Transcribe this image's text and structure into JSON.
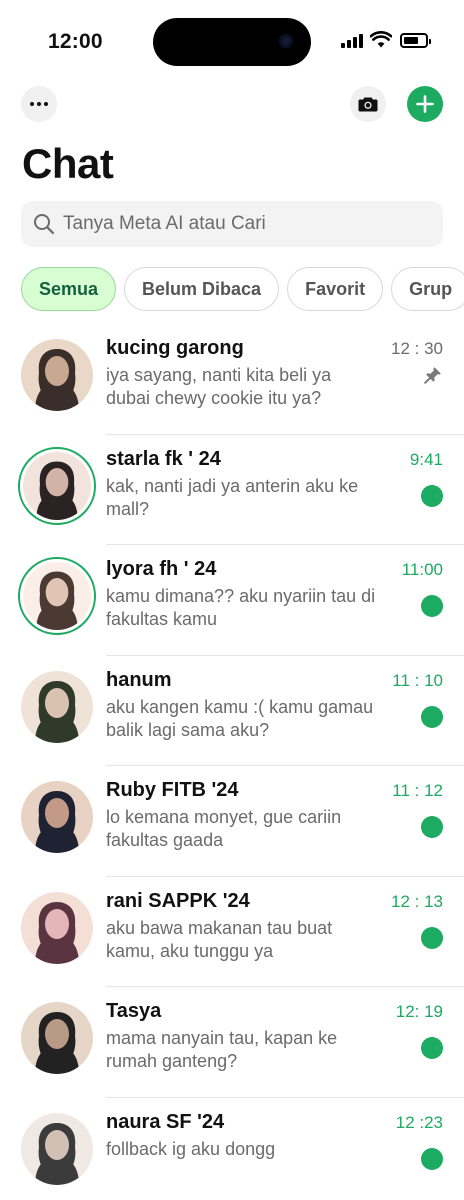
{
  "status_bar": {
    "time": "12:00",
    "battery_level": 0.7
  },
  "header": {
    "title": "Chat",
    "more_icon": "ellipsis-icon",
    "camera_icon": "camera-icon",
    "new_chat_icon": "plus-icon"
  },
  "search": {
    "placeholder": "Tanya Meta AI atau Cari"
  },
  "filters": [
    {
      "label": "Semua",
      "active": true
    },
    {
      "label": "Belum Dibaca",
      "active": false
    },
    {
      "label": "Favorit",
      "active": false
    },
    {
      "label": "Grup",
      "active": false
    }
  ],
  "chats": [
    {
      "name": "kucing garong",
      "message": "iya sayang, nanti kita beli ya dubai chewy cookie itu ya?",
      "time": "12 : 30",
      "unread": false,
      "pinned": true,
      "status_ring": false
    },
    {
      "name": "starla fk ' 24",
      "message": "kak, nanti jadi ya anterin aku ke mall?",
      "time": "9:41",
      "unread": true,
      "pinned": false,
      "status_ring": true
    },
    {
      "name": "lyora fh ' 24",
      "message": "kamu dimana?? aku nyariin tau di fakultas kamu",
      "time": "11:00",
      "unread": true,
      "pinned": false,
      "status_ring": true
    },
    {
      "name": "hanum",
      "message": "aku kangen kamu :( kamu gamau balik lagi sama aku?",
      "time": "11 : 10",
      "unread": true,
      "pinned": false,
      "status_ring": false
    },
    {
      "name": "Ruby FITB '24",
      "message": "lo kemana monyet, gue cariin fakultas gaada",
      "time": "11 : 12",
      "unread": true,
      "pinned": false,
      "status_ring": false
    },
    {
      "name": "rani  SAPPK '24",
      "message": "aku bawa makanan tau buat kamu, aku tunggu ya",
      "time": "12 : 13",
      "unread": true,
      "pinned": false,
      "status_ring": false
    },
    {
      "name": "Tasya",
      "message": "mama nanyain tau, kapan ke rumah ganteng?",
      "time": "12: 19",
      "unread": true,
      "pinned": false,
      "status_ring": false
    },
    {
      "name": "naura SF '24",
      "message": "follback ig aku dongg",
      "time": "12 :23",
      "unread": true,
      "pinned": false,
      "status_ring": false
    }
  ],
  "colors": {
    "accent": "#1daa61",
    "chip_active_bg": "#d8fdd2",
    "secondary_text": "#6b6b6b"
  }
}
